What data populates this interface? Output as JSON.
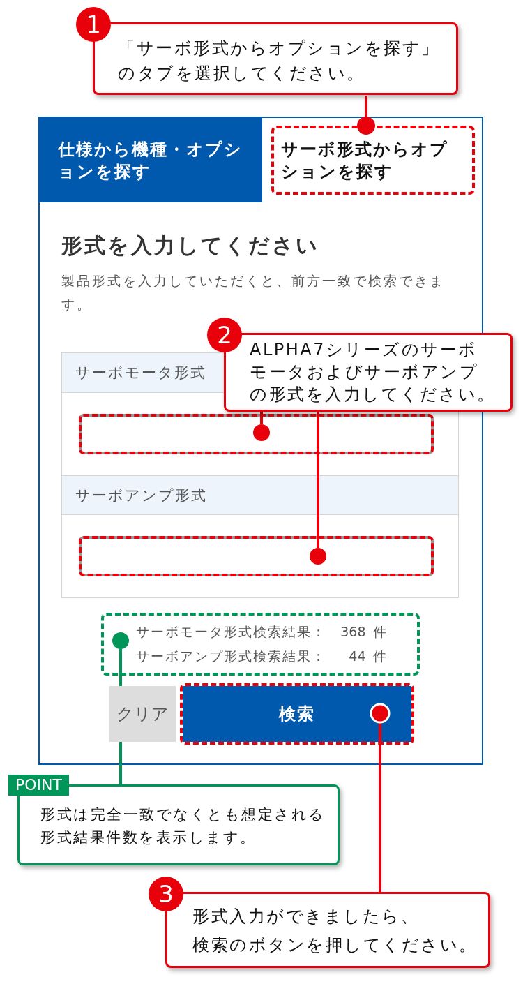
{
  "steps": [
    {
      "number": "1",
      "lines": [
        "「サーボ形式からオプションを探す」",
        "のタブを選択してください。"
      ]
    },
    {
      "number": "2",
      "lines": [
        "ALPHA7シリーズのサーボ",
        "モータおよびサーボアンプ",
        "の形式を入力してください。"
      ]
    },
    {
      "number": "3",
      "lines": [
        "形式入力ができましたら、",
        "検索のボタンを押してください。"
      ]
    }
  ],
  "panel": {
    "tabs": [
      {
        "label": "仕様から機種・オプションを探す",
        "selected": false
      },
      {
        "label": "サーボ形式からオプションを探す",
        "selected": true,
        "highlighted": true
      }
    ],
    "heading": "形式を入力してください",
    "description": "製品形式を入力していただくと、前方一致で検索できます。",
    "fields": [
      {
        "label": "サーボモータ形式",
        "highlighted": true
      },
      {
        "label": "サーボアンプ形式",
        "highlighted": true
      }
    ],
    "results": {
      "highlighted": true,
      "rows": [
        {
          "label": "サーボモータ形式検索結果：",
          "count": "368",
          "unit": "件"
        },
        {
          "label": "サーボアンプ形式検索結果：",
          "count": "44",
          "unit": "件"
        }
      ]
    },
    "buttons": [
      {
        "kind": "clear",
        "label": "クリア"
      },
      {
        "kind": "search",
        "label": "検索",
        "highlighted": true
      }
    ]
  },
  "point": {
    "tag": "POINT",
    "lines": [
      "形式は完全一致でなくとも想定される",
      "形式結果件数を表示します。"
    ]
  }
}
